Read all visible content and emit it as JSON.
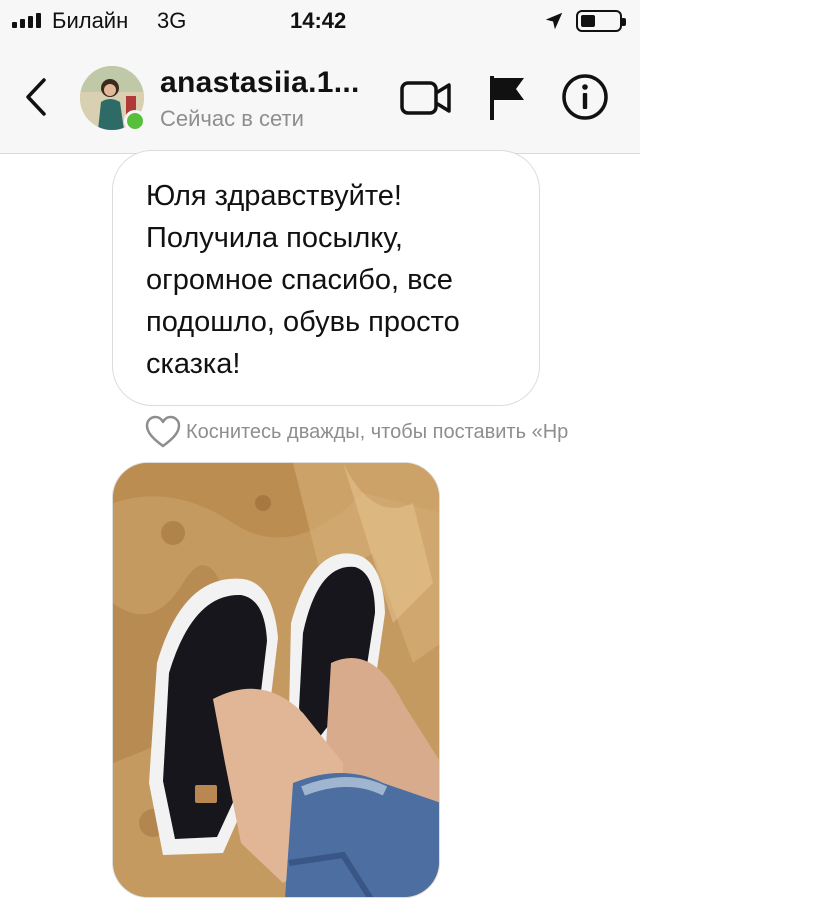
{
  "status_bar": {
    "carrier": "Билайн",
    "network": "3G",
    "time": "14:42",
    "location_icon": "location-arrow-icon",
    "battery_icon": "battery-icon",
    "signal_icon": "signal-bars-icon"
  },
  "header": {
    "username": "anastasiia.1...",
    "presence": "Сейчас в сети",
    "back_icon": "chevron-left-icon",
    "video_icon": "video-camera-icon",
    "flag_icon": "flag-icon",
    "info_icon": "info-icon",
    "online_color": "#56c03b"
  },
  "messages": [
    {
      "type": "text",
      "text": "Юля здравствуйте!\nПолучила посылку,\nогромное спасибо, все\nподошло, обувь просто\nсказка!"
    },
    {
      "type": "image",
      "description_icon": "photo-icon"
    }
  ],
  "like_hint": "Коснитесь дважды, чтобы поставить «Нр",
  "colors": {
    "secondary_text": "#8e8e8e",
    "bar_background": "#f7f7f7"
  }
}
